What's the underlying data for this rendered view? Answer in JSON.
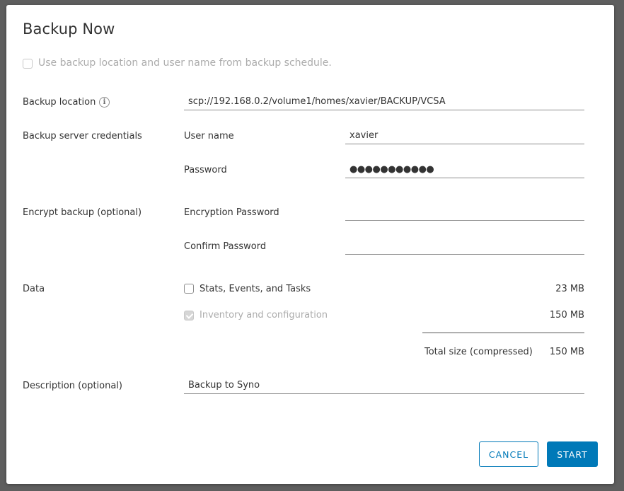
{
  "dialog": {
    "title": "Backup Now",
    "use_schedule_label": "Use backup location and user name from backup schedule."
  },
  "backup_location": {
    "label": "Backup location",
    "info_icon": "info-icon",
    "value": "scp://192.168.0.2/volume1/homes/xavier/BACKUP/VCSA"
  },
  "credentials": {
    "label": "Backup server credentials",
    "username_label": "User name",
    "username_value": "xavier",
    "password_label": "Password",
    "password_mask": "●●●●●●●●●●●"
  },
  "encrypt": {
    "label": "Encrypt backup (optional)",
    "encryption_password_label": "Encryption Password",
    "encryption_password_value": "",
    "confirm_password_label": "Confirm Password",
    "confirm_password_value": ""
  },
  "data": {
    "label": "Data",
    "items": [
      {
        "label": "Stats, Events, and Tasks",
        "size": "23 MB",
        "checked": false,
        "disabled": false
      },
      {
        "label": "Inventory and configuration",
        "size": "150 MB",
        "checked": true,
        "disabled": true
      }
    ],
    "total_label": "Total size (compressed)",
    "total_size": "150 MB"
  },
  "description": {
    "label": "Description (optional)",
    "value": "Backup to Syno"
  },
  "buttons": {
    "cancel": "CANCEL",
    "start": "START"
  },
  "colors": {
    "primary": "#0079b8",
    "overlay": "#5e5e5e"
  }
}
